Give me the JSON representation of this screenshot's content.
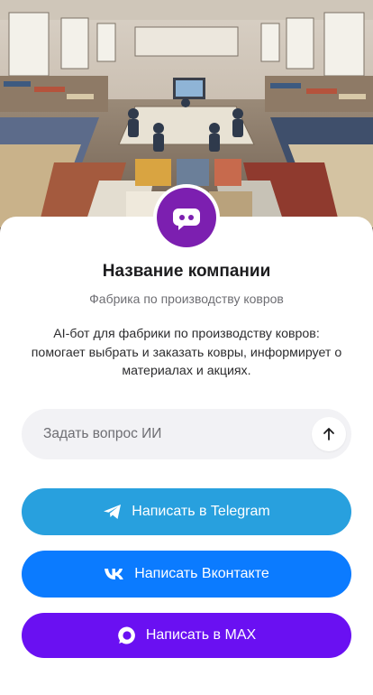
{
  "company": {
    "name": "Название компании",
    "subtitle": "Фабрика по производству ковров",
    "description": "AI-бот для фабрики по производству ковров: помогает выбрать и заказать ковры, информирует о материалах и акциях."
  },
  "ask": {
    "placeholder": "Задать вопрос ИИ"
  },
  "buttons": {
    "telegram": "Написать в Telegram",
    "vkontakte": "Написать Вконтакте",
    "max": "Написать в MAX"
  },
  "colors": {
    "avatar": "#7c1fb0",
    "telegram": "#28a0de",
    "vkontakte": "#0b7bff",
    "max": "#6a10f2"
  }
}
